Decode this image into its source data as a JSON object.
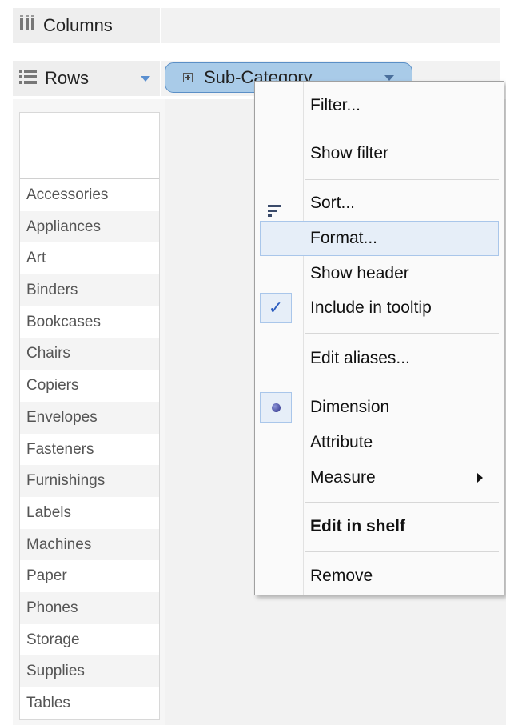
{
  "columns_shelf": {
    "label": "Columns",
    "icon": "columns-icon"
  },
  "rows_shelf": {
    "label": "Rows",
    "icon": "rows-icon"
  },
  "pill": {
    "label": "Sub-Category"
  },
  "row_headers": [
    "Accessories",
    "Appliances",
    "Art",
    "Binders",
    "Bookcases",
    "Chairs",
    "Copiers",
    "Envelopes",
    "Fasteners",
    "Furnishings",
    "Labels",
    "Machines",
    "Paper",
    "Phones",
    "Storage",
    "Supplies",
    "Tables"
  ],
  "context_menu": {
    "filter": "Filter...",
    "show_filter": "Show filter",
    "sort": "Sort...",
    "format": "Format...",
    "show_header": "Show header",
    "include_in_tooltip": "Include in tooltip",
    "edit_aliases": "Edit aliases...",
    "dimension": "Dimension",
    "attribute": "Attribute",
    "measure": "Measure",
    "edit_in_shelf": "Edit in shelf",
    "remove": "Remove"
  },
  "colors": {
    "pill_fill": "#a9cbe8",
    "pill_border": "#5b8fc6",
    "highlight": "#e6eef8",
    "check": "#2a5bbf"
  }
}
